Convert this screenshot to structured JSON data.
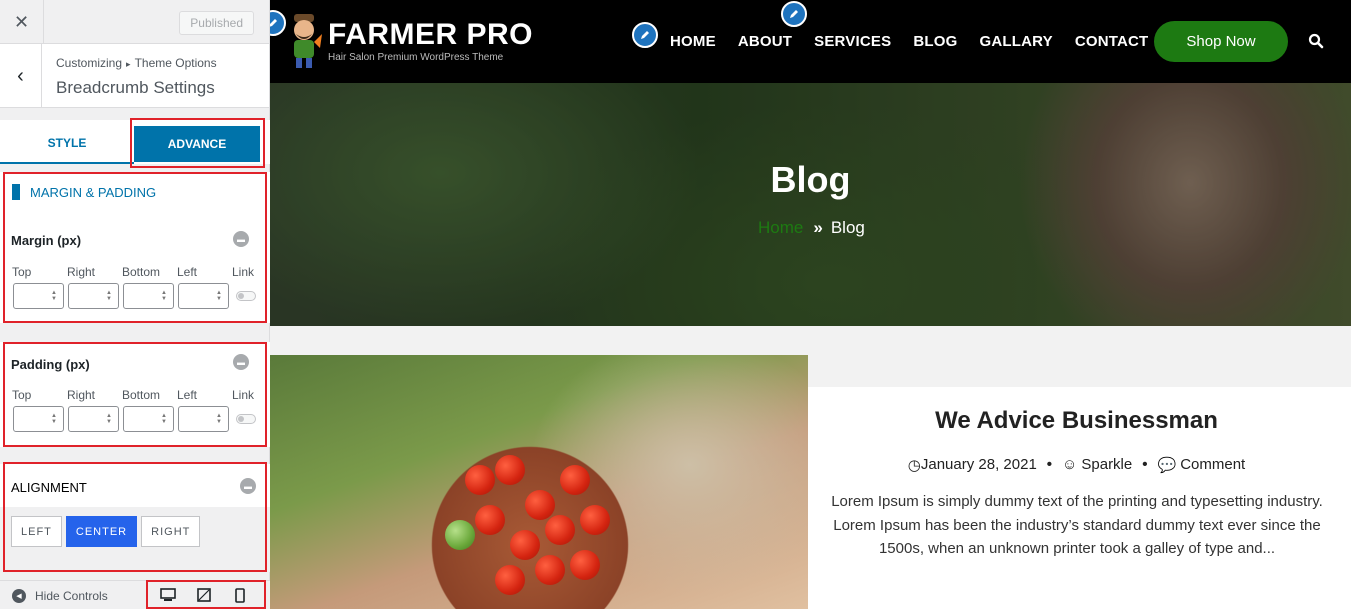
{
  "customizer": {
    "close_icon": "close-icon",
    "published_label": "Published",
    "breadcrumb": {
      "parent": "Customizing",
      "child": "Theme Options"
    },
    "section_title": "Breadcrumb Settings",
    "tabs": [
      {
        "label": "STYLE",
        "active": false
      },
      {
        "label": "ADVANCE",
        "active": true
      }
    ],
    "margin_padding_heading": "MARGIN & PADDING",
    "margin": {
      "label": "Margin (px)",
      "fields": [
        {
          "label": "Top",
          "value": ""
        },
        {
          "label": "Right",
          "value": ""
        },
        {
          "label": "Bottom",
          "value": ""
        },
        {
          "label": "Left",
          "value": ""
        }
      ],
      "link_label": "Link"
    },
    "padding": {
      "label": "Padding (px)",
      "fields": [
        {
          "label": "Top",
          "value": ""
        },
        {
          "label": "Right",
          "value": ""
        },
        {
          "label": "Bottom",
          "value": ""
        },
        {
          "label": "Left",
          "value": ""
        }
      ],
      "link_label": "Link"
    },
    "alignment": {
      "label": "ALIGNMENT",
      "options": [
        "LEFT",
        "CENTER",
        "RIGHT"
      ],
      "selected": "CENTER"
    },
    "footer": {
      "hide_controls": "Hide Controls",
      "devices": [
        "desktop-icon",
        "tablet-icon",
        "mobile-icon"
      ]
    }
  },
  "site": {
    "logo_title": "FARMER PRO",
    "logo_tagline": "Hair Salon Premium WordPress Theme",
    "nav": [
      "HOME",
      "ABOUT",
      "SERVICES",
      "BLOG",
      "GALLARY",
      "CONTACT"
    ],
    "shop_button": "Shop Now",
    "hero": {
      "title": "Blog",
      "crumb_home": "Home",
      "crumb_sep": "»",
      "crumb_current": "Blog"
    },
    "post": {
      "title": "We Advice Businessman",
      "date": "January 28, 2021",
      "author": "Sparkle",
      "comments": "Comment",
      "excerpt": "Lorem Ipsum is simply dummy text of the printing and typesetting industry. Lorem Ipsum has been the industry’s standard dummy text ever since the 1500s, when an unknown printer took a galley of type and..."
    }
  },
  "colors": {
    "accent_blue": "#0073aa",
    "highlight_red": "#e0222a",
    "brand_green": "#1d7a12",
    "active_blue": "#2563eb"
  }
}
